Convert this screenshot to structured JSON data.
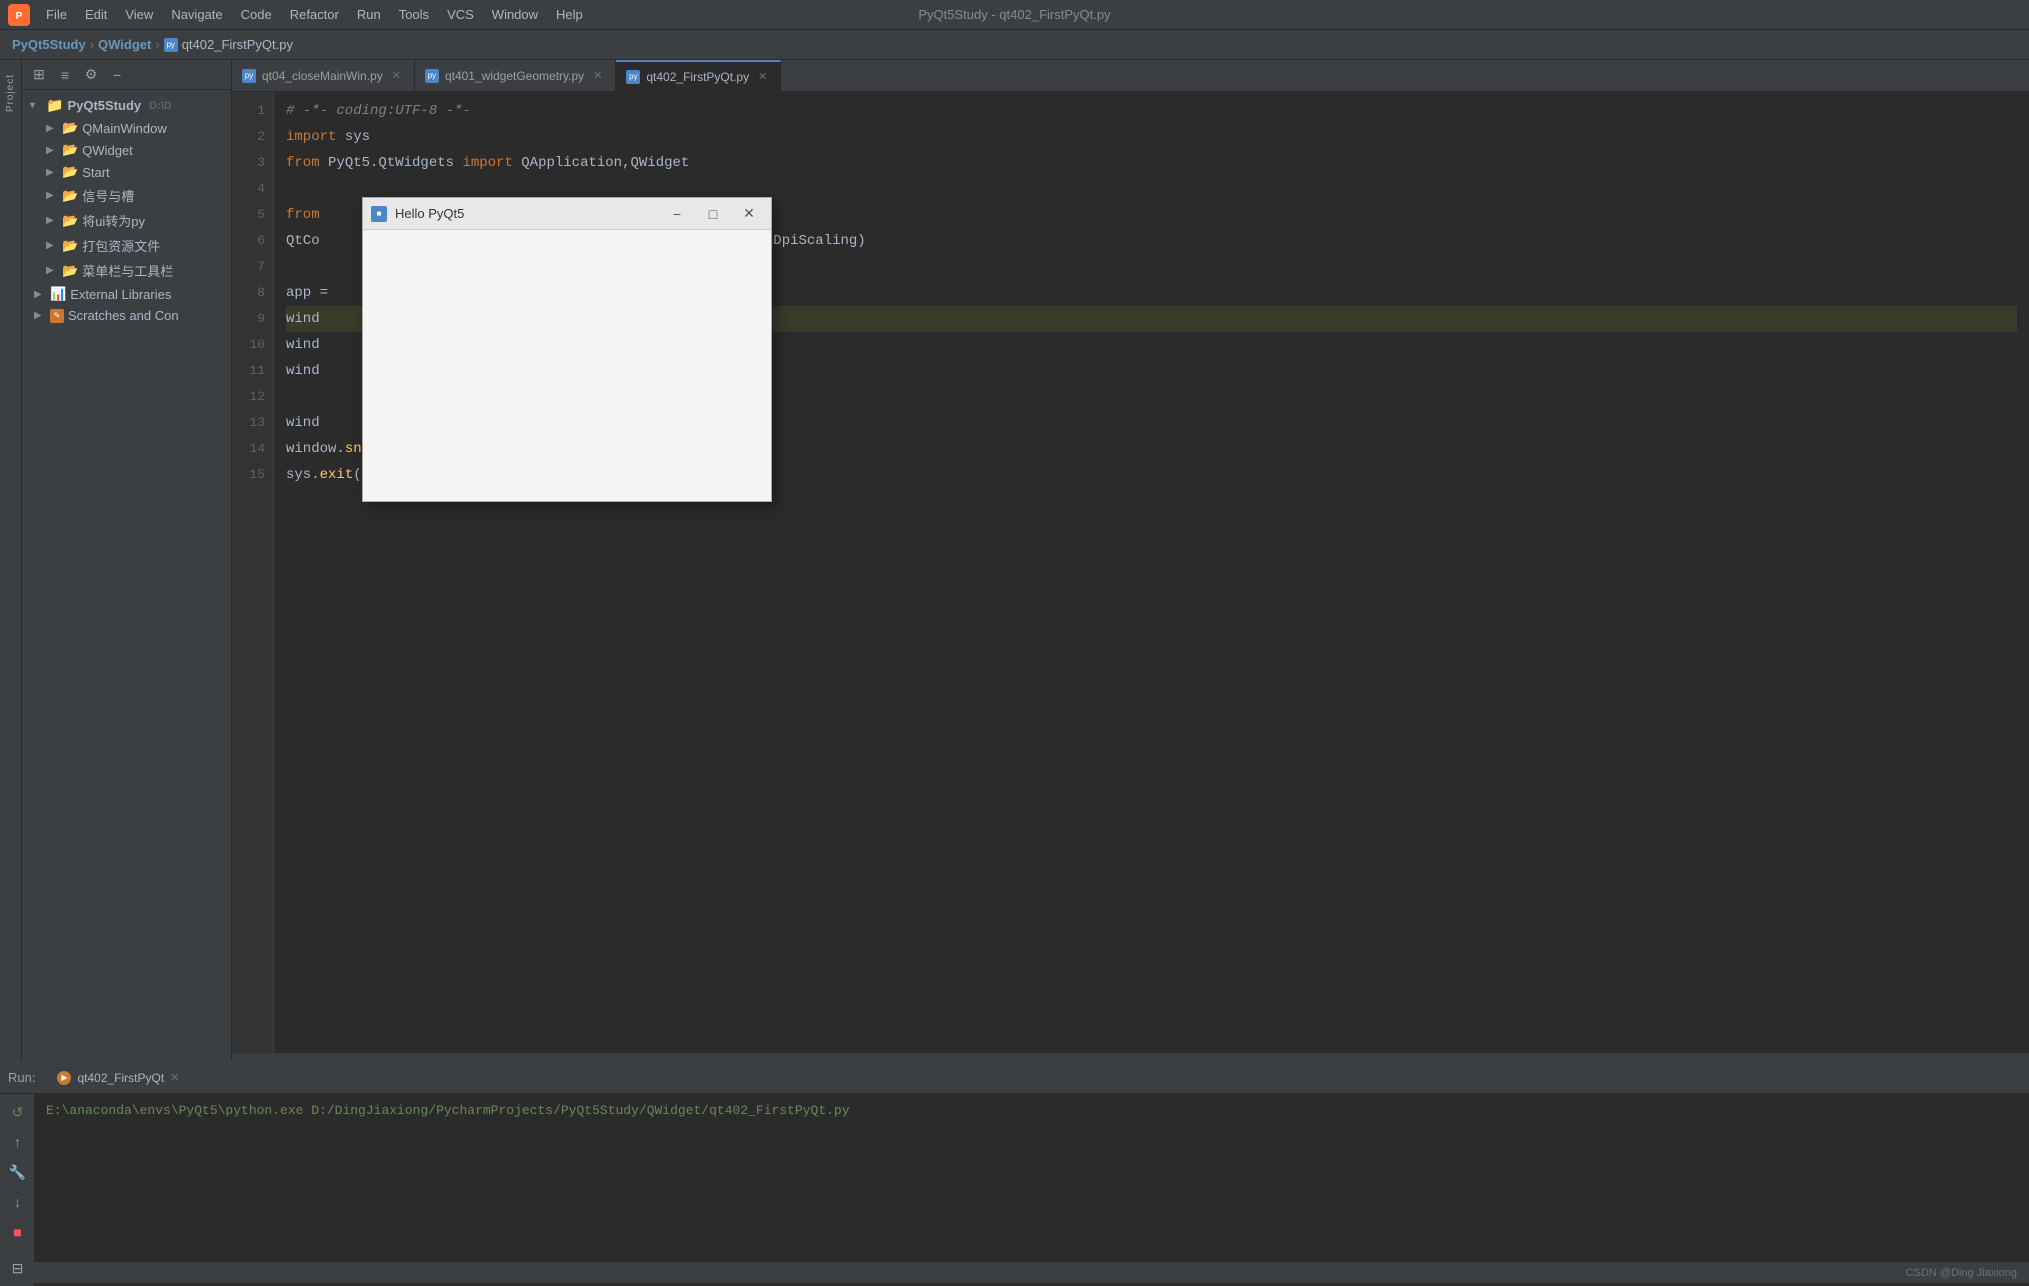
{
  "app": {
    "title": "PyQt5Study - qt402_FirstPyQt.py",
    "logo": "P"
  },
  "menu": {
    "items": [
      "File",
      "Edit",
      "View",
      "Navigate",
      "Code",
      "Refactor",
      "Run",
      "Tools",
      "VCS",
      "Window",
      "Help"
    ]
  },
  "breadcrumb": {
    "root": "PyQt5Study",
    "parent": "QWidget",
    "file": "qt402_FirstPyQt.py"
  },
  "tabs": [
    {
      "label": "qt04_closeMainWin.py",
      "active": false
    },
    {
      "label": "qt401_widgetGeometry.py",
      "active": false
    },
    {
      "label": "qt402_FirstPyQt.py",
      "active": true
    }
  ],
  "sidebar": {
    "project_label": "Project",
    "items": [
      {
        "label": "PyQt5Study",
        "path": "D:\\D",
        "level": 0,
        "expanded": true,
        "type": "root"
      },
      {
        "label": "QMainWindow",
        "level": 1,
        "expanded": false,
        "type": "folder"
      },
      {
        "label": "QWidget",
        "level": 1,
        "expanded": true,
        "type": "folder"
      },
      {
        "label": "Start",
        "level": 1,
        "expanded": false,
        "type": "folder"
      },
      {
        "label": "信号与槽",
        "level": 1,
        "expanded": false,
        "type": "folder"
      },
      {
        "label": "将ui转为py",
        "level": 1,
        "expanded": false,
        "type": "folder"
      },
      {
        "label": "打包资源文件",
        "level": 1,
        "expanded": false,
        "type": "folder"
      },
      {
        "label": "菜单栏与工具栏",
        "level": 1,
        "expanded": false,
        "type": "folder"
      },
      {
        "label": "External Libraries",
        "level": 0,
        "expanded": false,
        "type": "lib"
      },
      {
        "label": "Scratches and Con",
        "level": 0,
        "expanded": false,
        "type": "scratch"
      }
    ]
  },
  "code": {
    "lines": [
      {
        "num": 1,
        "content": "# -*- coding:UTF-8 -*-",
        "type": "comment"
      },
      {
        "num": 2,
        "content": "import sys",
        "type": "code"
      },
      {
        "num": 3,
        "content": "from PyQt5.QtWidgets import QApplication,QWidget",
        "type": "code"
      },
      {
        "num": 4,
        "content": "",
        "type": "blank"
      },
      {
        "num": 5,
        "content": "from                                    import QtCore",
        "type": "code",
        "hidden": true
      },
      {
        "num": 6,
        "content": "QtCo                                    e.Qt.AA_EnableHighDpiScaling)",
        "type": "code",
        "hidden": true
      },
      {
        "num": 7,
        "content": "",
        "type": "blank"
      },
      {
        "num": 8,
        "content": "app =",
        "type": "code",
        "hidden": true
      },
      {
        "num": 9,
        "content": "wind",
        "type": "code",
        "highlighted": true,
        "hidden": true
      },
      {
        "num": 10,
        "content": "wind",
        "type": "code",
        "hidden": true
      },
      {
        "num": 11,
        "content": "wind",
        "type": "code",
        "hidden": true
      },
      {
        "num": 12,
        "content": "",
        "type": "blank"
      },
      {
        "num": 13,
        "content": "wind",
        "type": "code",
        "hidden": true
      },
      {
        "num": 14,
        "content": "window.snow()",
        "type": "code"
      },
      {
        "num": 15,
        "content": "sys.exit(app.exec_())",
        "type": "code"
      }
    ]
  },
  "floating_window": {
    "title": "Hello PyQt5",
    "icon": "■"
  },
  "run_panel": {
    "label": "Run:",
    "tab": "qt402_FirstPyQt",
    "command": "E:\\anaconda\\envs\\PyQt5\\python.exe D:/DingJiaxiong/PycharmProjects/PyQt5Study/QWidget/qt402_FirstPyQt.py"
  },
  "status_bar": {
    "text": "CSDN @Ding Jiaxiong"
  }
}
